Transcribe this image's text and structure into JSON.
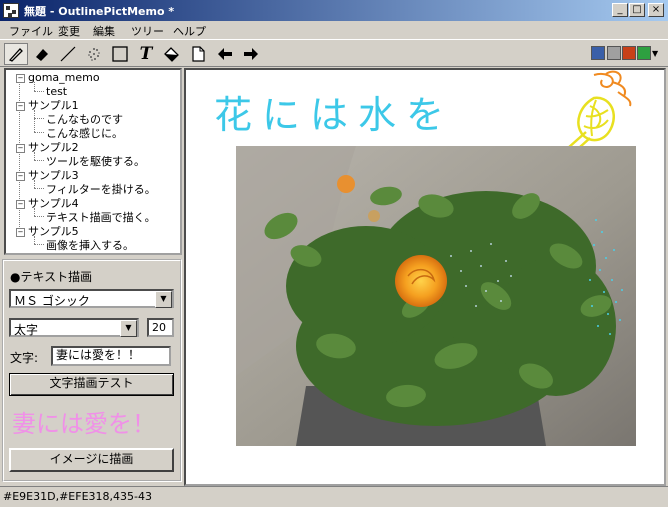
{
  "window": {
    "title": "無題 - OutlinePictMemo *",
    "min": "_",
    "max": "□",
    "close": "×"
  },
  "menu": [
    "ファイル",
    "変更",
    "編集",
    "ツリー",
    "ヘルプ"
  ],
  "toolbar": {
    "text_tool_glyph": "T",
    "swatches": [
      "#3a5fa8",
      "#a0a0a0",
      "#c84018",
      "#2ea040"
    ]
  },
  "tree": {
    "nodes": [
      {
        "label": "goma_memo",
        "expander": "−"
      },
      {
        "label": "test"
      },
      {
        "label": "サンプル1",
        "expander": "−"
      },
      {
        "label": "こんなものです"
      },
      {
        "label": "こんな感じに。"
      },
      {
        "label": "サンプル2",
        "expander": "−"
      },
      {
        "label": "ツールを駆使する。"
      },
      {
        "label": "サンプル3",
        "expander": "−"
      },
      {
        "label": "フィルターを掛ける。"
      },
      {
        "label": "サンプル4",
        "expander": "−"
      },
      {
        "label": "テキスト描画で描く。"
      },
      {
        "label": "サンプル5",
        "expander": "−"
      },
      {
        "label": "画像を挿入する。"
      }
    ]
  },
  "panel": {
    "heading": "●テキスト描画",
    "font": "ＭＳ ゴシック",
    "style": "太字",
    "size": "20",
    "text_label": "文字:",
    "text_value": "妻には愛を！！",
    "test_button": "文字描画テスト",
    "preview": "妻には愛を！",
    "preview_color": "#f090e8",
    "draw_button": "イメージに描画"
  },
  "canvas": {
    "handwriting": "花には水を",
    "handwriting_color": "#3cc8e8"
  },
  "status": "#E9E31D,#EFE318,435-43"
}
